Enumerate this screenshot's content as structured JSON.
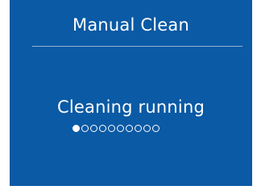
{
  "screen": {
    "title": "Manual Clean",
    "status_text": "Cleaning running",
    "progress": {
      "total_steps": 10,
      "current_step": 1
    },
    "colors": {
      "background": "#0a5aa5",
      "text": "#ffffff"
    }
  }
}
